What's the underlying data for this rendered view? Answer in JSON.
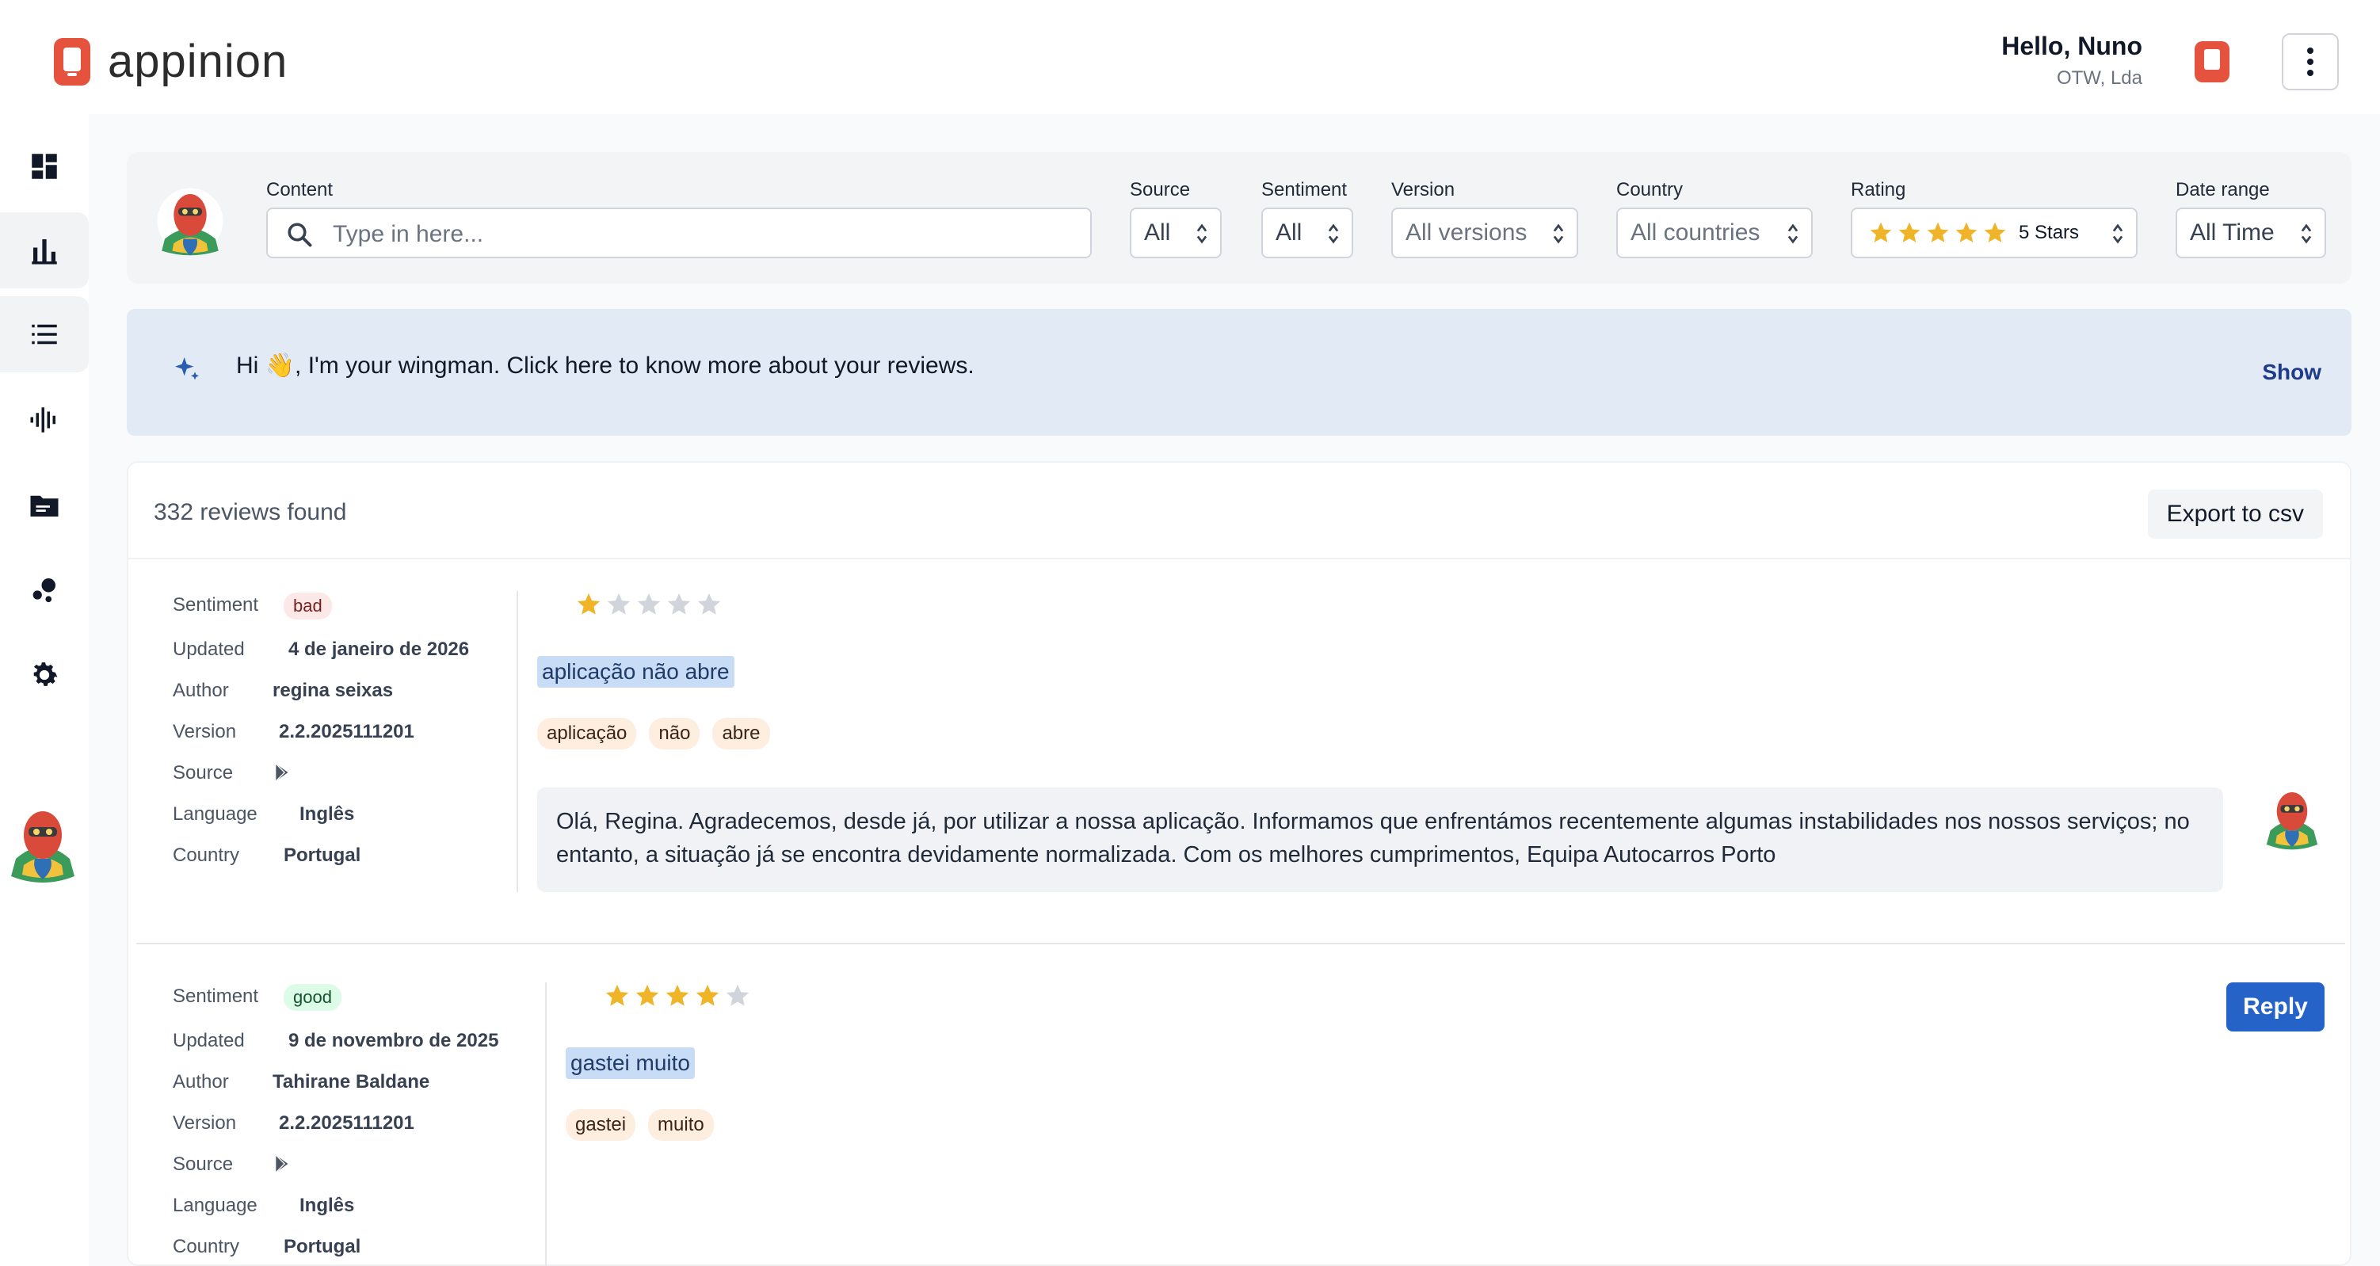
{
  "header": {
    "app_name": "appinion",
    "greeting": "Hello, Nuno",
    "organization": "OTW, Lda"
  },
  "sidebar": {
    "items": [
      {
        "name": "dashboard",
        "icon": "dashboard-icon"
      },
      {
        "name": "analytics",
        "icon": "bar-chart-icon",
        "active": true
      },
      {
        "name": "reviews",
        "icon": "list-icon",
        "active": true
      },
      {
        "name": "insights",
        "icon": "audio-wave-icon"
      },
      {
        "name": "folders",
        "icon": "folder-icon"
      },
      {
        "name": "clusters",
        "icon": "bubbles-icon"
      },
      {
        "name": "settings",
        "icon": "gear-icon"
      }
    ]
  },
  "filters": {
    "content_label": "Content",
    "content_placeholder": "Type in here...",
    "source_label": "Source",
    "source_value": "All",
    "sentiment_label": "Sentiment",
    "sentiment_value": "All",
    "version_label": "Version",
    "version_value": "All versions",
    "country_label": "Country",
    "country_value": "All countries",
    "rating_label": "Rating",
    "rating_value": "5 Stars",
    "rating_stars": 5,
    "date_label": "Date range",
    "date_value": "All Time"
  },
  "wingman": {
    "message": "Hi 👋, I'm your wingman. Click here to know more about your reviews.",
    "show_label": "Show"
  },
  "reviews": {
    "count_text": "332 reviews found",
    "export_label": "Export to csv",
    "meta_labels": {
      "sentiment": "Sentiment",
      "updated": "Updated",
      "author": "Author",
      "version": "Version",
      "source": "Source",
      "language": "Language",
      "country": "Country"
    },
    "items": [
      {
        "sentiment": "bad",
        "updated": "4 de janeiro de 2026",
        "author": "regina seixas",
        "version": "2.2.2025111201",
        "source_icon": "google-play-icon",
        "language": "Inglês",
        "country": "Portugal",
        "rating": 1,
        "title": "aplicação não abre",
        "tags": [
          "aplicação",
          "não",
          "abre"
        ],
        "reply": "Olá, Regina. Agradecemos, desde já, por utilizar a nossa aplicação. Informamos que enfrentámos recentemente algumas instabilidades nos nossos serviços; no entanto, a situação já se encontra devidamente normalizada. Com os melhores cumprimentos, Equipa Autocarros Porto"
      },
      {
        "sentiment": "good",
        "updated": "9 de novembro de 2025",
        "author": "Tahirane Baldane",
        "version": "2.2.2025111201",
        "source_icon": "google-play-icon",
        "language": "Inglês",
        "country": "Portugal",
        "rating": 4,
        "title": "gastei muito",
        "tags": [
          "gastei",
          "muito"
        ],
        "reply_button": "Reply"
      }
    ]
  },
  "colors": {
    "brand": "#e5533f",
    "star_filled": "#f0b429",
    "star_empty": "#d1d5db",
    "primary_button": "#2563c9"
  }
}
